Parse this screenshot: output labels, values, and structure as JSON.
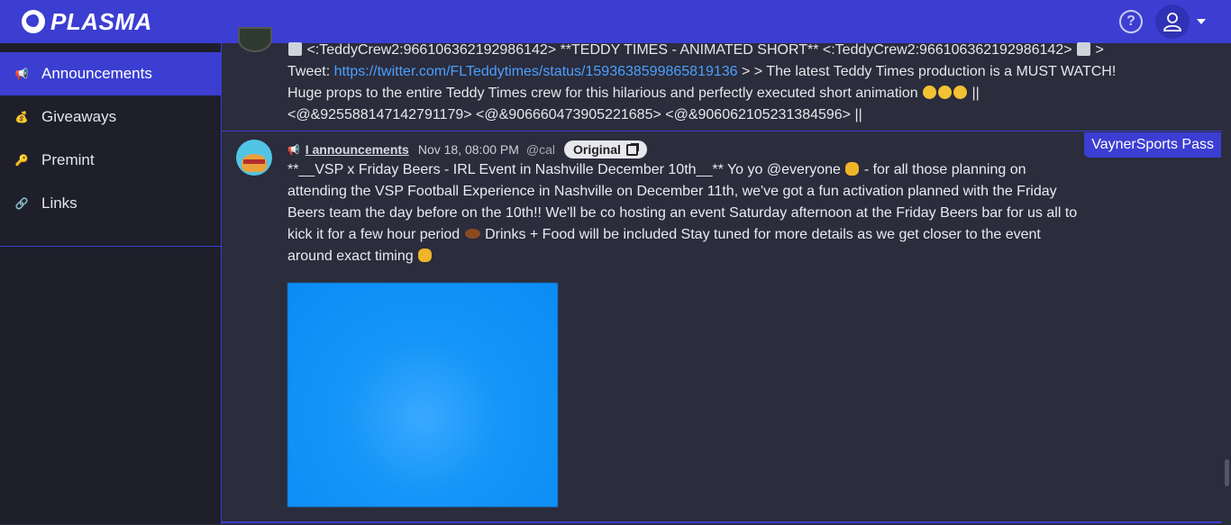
{
  "app": {
    "title": "PLASMA"
  },
  "colors": {
    "accent": "#3b3ed1",
    "sidebar_bg": "#1e1f2b",
    "main_bg": "#2b2c3c",
    "link": "#4aa0ff"
  },
  "header": {
    "help_icon": "help-icon",
    "user_icon": "user-icon"
  },
  "sidebar": {
    "items": [
      {
        "label": "Announcements",
        "icon": "megaphone-icon",
        "active": true
      },
      {
        "label": "Giveaways",
        "icon": "money-bag-icon",
        "active": false
      },
      {
        "label": "Premint",
        "icon": "key-icon",
        "active": false
      },
      {
        "label": "Links",
        "icon": "link-icon",
        "active": false
      }
    ]
  },
  "prev_message": {
    "line1": "<:TeddyCrew2:966106362192986142> **TEDDY TIMES - ANIMATED SHORT** <:TeddyCrew2:966106362192986142>",
    "line1_end": ">",
    "tweet_prefix": "Tweet: ",
    "tweet_link": "https://twitter.com/FLTeddytimes/status/1593638599865819136",
    "line2_rest": " > > The latest Teddy Times production is a MUST WATCH! Huge props to the entire Teddy Times crew for this hilarious and perfectly executed short animation",
    "line3_end": " ||",
    "line4": "<@&925588147142791179> <@&906660473905221685> <@&906062105231384596> ||"
  },
  "message": {
    "channel": "I announcements",
    "timestamp": "Nov 18, 08:00 PM",
    "handle": "@cal",
    "original_label": "Original",
    "server_tag": "VaynerSports Pass",
    "body_part1": "**__VSP x Friday Beers - IRL Event in Nashville December 10th__** Yo yo @everyone",
    "body_part2": " - for all those planning on attending the VSP Football Experience in Nashville on December 11th, we've got a fun activation planned with the Friday Beers team the day before on the 10th!! We'll be co hosting an event Saturday afternoon at the Friday Beers bar for us all to kick it for a few hour period",
    "body_part3": " Drinks + Food will be included Stay tuned for more details as we get closer to the event around exact timing"
  }
}
